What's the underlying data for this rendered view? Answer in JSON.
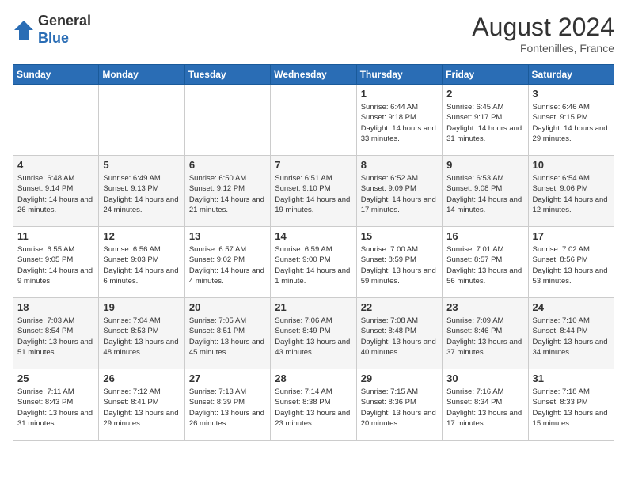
{
  "header": {
    "logo_line1": "General",
    "logo_line2": "Blue",
    "month_year": "August 2024",
    "location": "Fontenilles, France"
  },
  "days_of_week": [
    "Sunday",
    "Monday",
    "Tuesday",
    "Wednesday",
    "Thursday",
    "Friday",
    "Saturday"
  ],
  "weeks": [
    [
      {
        "day": "",
        "info": ""
      },
      {
        "day": "",
        "info": ""
      },
      {
        "day": "",
        "info": ""
      },
      {
        "day": "",
        "info": ""
      },
      {
        "day": "1",
        "info": "Sunrise: 6:44 AM\nSunset: 9:18 PM\nDaylight: 14 hours\nand 33 minutes."
      },
      {
        "day": "2",
        "info": "Sunrise: 6:45 AM\nSunset: 9:17 PM\nDaylight: 14 hours\nand 31 minutes."
      },
      {
        "day": "3",
        "info": "Sunrise: 6:46 AM\nSunset: 9:15 PM\nDaylight: 14 hours\nand 29 minutes."
      }
    ],
    [
      {
        "day": "4",
        "info": "Sunrise: 6:48 AM\nSunset: 9:14 PM\nDaylight: 14 hours\nand 26 minutes."
      },
      {
        "day": "5",
        "info": "Sunrise: 6:49 AM\nSunset: 9:13 PM\nDaylight: 14 hours\nand 24 minutes."
      },
      {
        "day": "6",
        "info": "Sunrise: 6:50 AM\nSunset: 9:12 PM\nDaylight: 14 hours\nand 21 minutes."
      },
      {
        "day": "7",
        "info": "Sunrise: 6:51 AM\nSunset: 9:10 PM\nDaylight: 14 hours\nand 19 minutes."
      },
      {
        "day": "8",
        "info": "Sunrise: 6:52 AM\nSunset: 9:09 PM\nDaylight: 14 hours\nand 17 minutes."
      },
      {
        "day": "9",
        "info": "Sunrise: 6:53 AM\nSunset: 9:08 PM\nDaylight: 14 hours\nand 14 minutes."
      },
      {
        "day": "10",
        "info": "Sunrise: 6:54 AM\nSunset: 9:06 PM\nDaylight: 14 hours\nand 12 minutes."
      }
    ],
    [
      {
        "day": "11",
        "info": "Sunrise: 6:55 AM\nSunset: 9:05 PM\nDaylight: 14 hours\nand 9 minutes."
      },
      {
        "day": "12",
        "info": "Sunrise: 6:56 AM\nSunset: 9:03 PM\nDaylight: 14 hours\nand 6 minutes."
      },
      {
        "day": "13",
        "info": "Sunrise: 6:57 AM\nSunset: 9:02 PM\nDaylight: 14 hours\nand 4 minutes."
      },
      {
        "day": "14",
        "info": "Sunrise: 6:59 AM\nSunset: 9:00 PM\nDaylight: 14 hours\nand 1 minute."
      },
      {
        "day": "15",
        "info": "Sunrise: 7:00 AM\nSunset: 8:59 PM\nDaylight: 13 hours\nand 59 minutes."
      },
      {
        "day": "16",
        "info": "Sunrise: 7:01 AM\nSunset: 8:57 PM\nDaylight: 13 hours\nand 56 minutes."
      },
      {
        "day": "17",
        "info": "Sunrise: 7:02 AM\nSunset: 8:56 PM\nDaylight: 13 hours\nand 53 minutes."
      }
    ],
    [
      {
        "day": "18",
        "info": "Sunrise: 7:03 AM\nSunset: 8:54 PM\nDaylight: 13 hours\nand 51 minutes."
      },
      {
        "day": "19",
        "info": "Sunrise: 7:04 AM\nSunset: 8:53 PM\nDaylight: 13 hours\nand 48 minutes."
      },
      {
        "day": "20",
        "info": "Sunrise: 7:05 AM\nSunset: 8:51 PM\nDaylight: 13 hours\nand 45 minutes."
      },
      {
        "day": "21",
        "info": "Sunrise: 7:06 AM\nSunset: 8:49 PM\nDaylight: 13 hours\nand 43 minutes."
      },
      {
        "day": "22",
        "info": "Sunrise: 7:08 AM\nSunset: 8:48 PM\nDaylight: 13 hours\nand 40 minutes."
      },
      {
        "day": "23",
        "info": "Sunrise: 7:09 AM\nSunset: 8:46 PM\nDaylight: 13 hours\nand 37 minutes."
      },
      {
        "day": "24",
        "info": "Sunrise: 7:10 AM\nSunset: 8:44 PM\nDaylight: 13 hours\nand 34 minutes."
      }
    ],
    [
      {
        "day": "25",
        "info": "Sunrise: 7:11 AM\nSunset: 8:43 PM\nDaylight: 13 hours\nand 31 minutes."
      },
      {
        "day": "26",
        "info": "Sunrise: 7:12 AM\nSunset: 8:41 PM\nDaylight: 13 hours\nand 29 minutes."
      },
      {
        "day": "27",
        "info": "Sunrise: 7:13 AM\nSunset: 8:39 PM\nDaylight: 13 hours\nand 26 minutes."
      },
      {
        "day": "28",
        "info": "Sunrise: 7:14 AM\nSunset: 8:38 PM\nDaylight: 13 hours\nand 23 minutes."
      },
      {
        "day": "29",
        "info": "Sunrise: 7:15 AM\nSunset: 8:36 PM\nDaylight: 13 hours\nand 20 minutes."
      },
      {
        "day": "30",
        "info": "Sunrise: 7:16 AM\nSunset: 8:34 PM\nDaylight: 13 hours\nand 17 minutes."
      },
      {
        "day": "31",
        "info": "Sunrise: 7:18 AM\nSunset: 8:33 PM\nDaylight: 13 hours\nand 15 minutes."
      }
    ]
  ]
}
